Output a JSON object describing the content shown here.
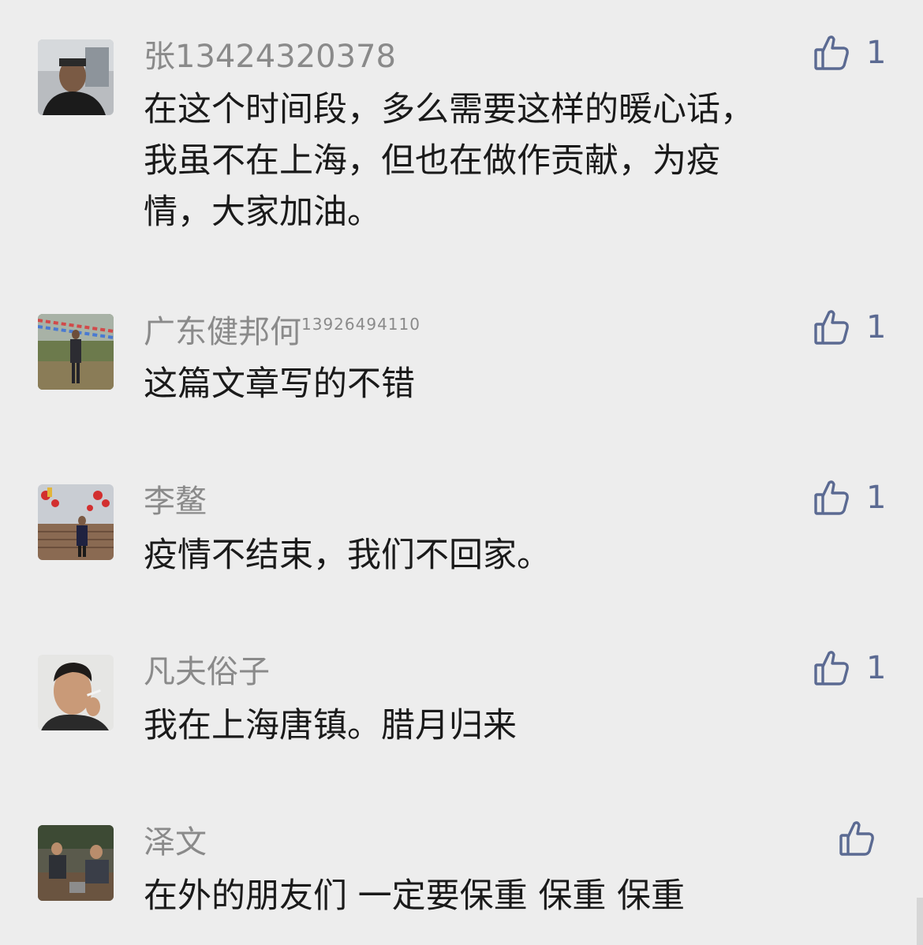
{
  "comments": [
    {
      "name": "张13424320378",
      "name_suffix": "",
      "text": "在这个时间段，多么需要这样的暖心话，\n我虽不在上海，但也在做作贡献，为疫\n情，大家加油。",
      "likes": "1",
      "avatar": "avatar-man-dark-shirt"
    },
    {
      "name": "广东健邦何",
      "name_suffix": "13926494110",
      "text": "这篇文章写的不错",
      "likes": "1",
      "avatar": "avatar-man-outdoor-flags"
    },
    {
      "name": "李鳌",
      "name_suffix": "",
      "text": "疫情不结束，我们不回家。",
      "likes": "1",
      "avatar": "avatar-man-bridge-lanterns"
    },
    {
      "name": "凡夫俗子",
      "name_suffix": "",
      "text": "我在上海唐镇。腊月归来",
      "likes": "1",
      "avatar": "avatar-young-man-smoking"
    },
    {
      "name": "泽文",
      "name_suffix": "",
      "text": "在外的朋友们 一定要保重 保重 保重",
      "likes": "",
      "avatar": "avatar-men-outdoor-work"
    }
  ],
  "colors": {
    "background": "#ededed",
    "name": "#8a8a8a",
    "text": "#1a1a1a",
    "like": "#5b6a92"
  },
  "icons": {
    "like": "thumbs-up-icon"
  }
}
